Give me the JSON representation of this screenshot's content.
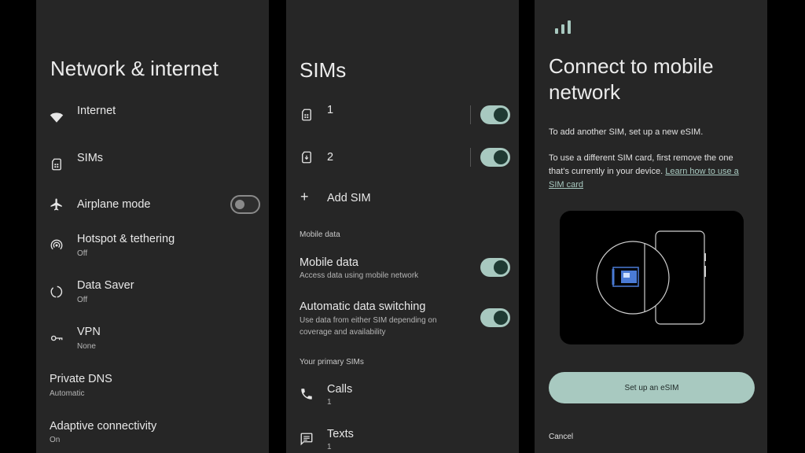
{
  "network_internet": {
    "title": "Network & internet",
    "items": [
      {
        "label": "Internet",
        "sub": "",
        "icon": "wifi-icon"
      },
      {
        "label": "SIMs",
        "sub": "",
        "icon": "sim-card-icon"
      },
      {
        "label": "Airplane mode",
        "sub": "",
        "icon": "airplane-icon",
        "toggle": "off"
      },
      {
        "label": "Hotspot & tethering",
        "sub": "Off",
        "icon": "hotspot-icon"
      },
      {
        "label": "Data Saver",
        "sub": "Off",
        "icon": "data-saver-icon"
      },
      {
        "label": "VPN",
        "sub": "None",
        "icon": "vpn-key-icon"
      },
      {
        "label": "Private DNS",
        "sub": "Automatic"
      },
      {
        "label": "Adaptive connectivity",
        "sub": "On"
      }
    ]
  },
  "sims": {
    "title": "SIMs",
    "sim_list": [
      {
        "label": "1",
        "icon": "sim-card-icon",
        "toggle": "on"
      },
      {
        "label": "2",
        "icon": "esim-icon",
        "toggle": "on"
      }
    ],
    "add_sim": "Add SIM",
    "mobile_data_section": "Mobile data",
    "mobile_data": {
      "label": "Mobile data",
      "sub": "Access data using mobile network",
      "toggle": "on"
    },
    "auto_switch": {
      "label": "Automatic data switching",
      "sub_line1": "Use data from either SIM depending on",
      "sub_line2": "coverage and availability",
      "toggle": "on"
    },
    "primary_section": "Your primary SIMs",
    "calls": {
      "label": "Calls",
      "sub": "1",
      "icon": "phone-icon"
    },
    "texts": {
      "label": "Texts",
      "sub": "1",
      "icon": "message-icon"
    }
  },
  "connect": {
    "title_line1": "Connect to mobile",
    "title_line2": "network",
    "para1": "To add another SIM, set up a new eSIM.",
    "para2_line1": "To use a different SIM card, first remove the one",
    "para2_line2_prefix": "that's currently in your device. ",
    "para2_link_line2": "Learn how to use a",
    "para2_link_line3": "SIM card",
    "setup_button": "Set up an eSIM",
    "cancel": "Cancel",
    "accent_color": "#a8c9c0"
  }
}
